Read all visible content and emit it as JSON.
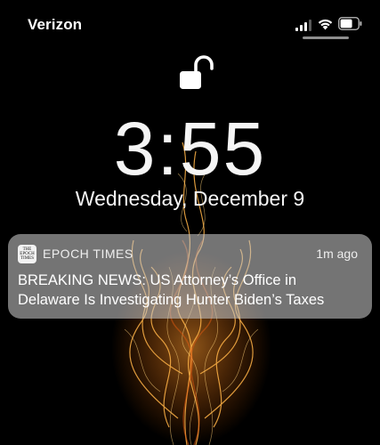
{
  "status_bar": {
    "carrier": "Verizon",
    "signal_icon": "cellular-signal-icon",
    "wifi_icon": "wifi-icon",
    "battery_icon": "battery-icon"
  },
  "lock_icon": "unlocked-padlock-icon",
  "time": "3:55",
  "date": "Wednesday, December 9",
  "notification": {
    "app_name": "EPOCH TIMES",
    "app_icon_text": [
      "THE",
      "EPOCH",
      "TIMES"
    ],
    "received": "1m ago",
    "body_lines": [
      "BREAKING NEWS: US Attorney’s Office in",
      "Delaware Is Investigating Hunter Biden’s Taxes"
    ]
  }
}
